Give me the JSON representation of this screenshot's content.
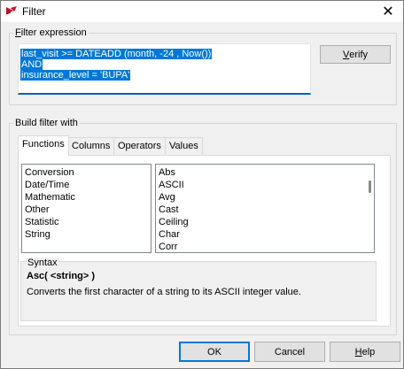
{
  "window": {
    "title": "Filter",
    "close_glyph": "✕"
  },
  "filter_expression": {
    "group_label_mnemonic": "F",
    "group_label_rest": "ilter expression",
    "lines": [
      "last_visit >= DATEADD (month, -24 , Now())",
      "AND",
      "insurance_level = 'BUPA'"
    ],
    "verify_mnemonic": "V",
    "verify_rest": "erify"
  },
  "build": {
    "group_label": "Build filter with",
    "tabs": [
      "Functions",
      "Columns",
      "Operators",
      "Values"
    ],
    "active_tab": "Functions",
    "categories": [
      "Conversion",
      "Date/Time",
      "Mathematic",
      "Other",
      "Statistic",
      "String"
    ],
    "functions": [
      "Abs",
      "ASCII",
      "Avg",
      "Cast",
      "Ceiling",
      "Char",
      "Corr"
    ],
    "syntax": {
      "label": "Syntax",
      "signature": "Asc( <string> )",
      "description": "Converts the first character of a string to its ASCII integer value."
    }
  },
  "buttons": {
    "ok": "OK",
    "cancel": "Cancel",
    "help_mnemonic": "H",
    "help_rest": "elp"
  },
  "colors": {
    "selection": "#0078d7",
    "focus_underline": "#0063b1",
    "dialog_bg": "#f0f0f0"
  },
  "icons": {
    "app": "filter-app-icon",
    "close": "close-icon"
  }
}
